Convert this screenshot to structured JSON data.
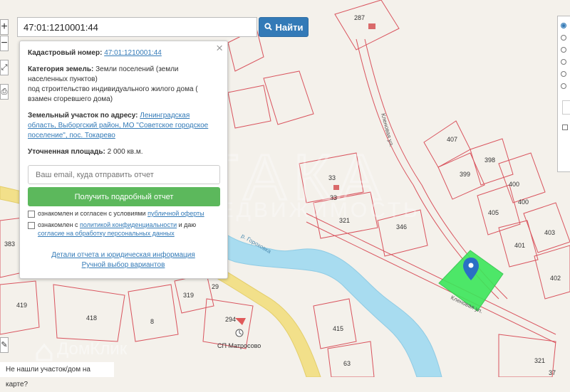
{
  "search": {
    "value": "47:01:1210001:44",
    "button_label": "Найти"
  },
  "info": {
    "cadastral_label": "Кадастровый номер:",
    "cadastral_value": "47:01:1210001:44",
    "category_label": "Категория земель:",
    "category_value_1": "Земли поселений (земли",
    "category_value_2": "населенных пунктов)",
    "category_value_3": "под строительство индивидуального жилого дома (",
    "category_value_4": "взамен сгоревшего дома)",
    "address_label": "Земельный участок по адресу:",
    "address_value_1": "Ленинградская",
    "address_value_2": "область, Выборгский район, МО \"Советское городское",
    "address_value_3": "поселение\", пос. Токарево",
    "area_label": "Уточненная площадь:",
    "area_value": "2 000 кв.м.",
    "email_placeholder": "Ваш email, куда отправить отчет",
    "report_button": "Получить подробный отчет",
    "consent_1_pre": "ознакомлен и согласен с условиями",
    "consent_1_link": "публичной оферты",
    "consent_2_pre": "ознакомлен с",
    "consent_2_link_1": "политикой конфиденциальности",
    "consent_2_mid": "и даю",
    "consent_2_link_2": "согласие на обработку персональных данных",
    "details_link": "Детали отчета и юридическая информация",
    "manual_link": "Ручной выбор вариантов"
  },
  "bottom_prompt": "Не нашли участок/дом на карте?",
  "watermarks": {
    "itaka": "ИТАКА",
    "itaka_sub": "НЕДВИЖИМОСТЬ",
    "domclick": "ДомКлик"
  },
  "map_labels": {
    "street_1": "Кленовая ул.",
    "street_2": "Кленовая ул.",
    "river": "р. Гороховка",
    "poi": "СП Матросово"
  },
  "parcels": [
    "287",
    "33",
    "33",
    "321",
    "346",
    "407",
    "399",
    "398",
    "400",
    "400",
    "405",
    "403",
    "401",
    "402",
    "383",
    "419",
    "418",
    "8",
    "319",
    "29",
    "294",
    "415",
    "63",
    "321",
    "37"
  ],
  "colors": {
    "accent": "#337ab7",
    "button_green": "#5cb85c",
    "parcel_border": "#d9545e",
    "selected_parcel": "#3ce65a",
    "marker": "#2a6fc4",
    "river": "#a8dcf0",
    "road": "#f2e08a"
  }
}
